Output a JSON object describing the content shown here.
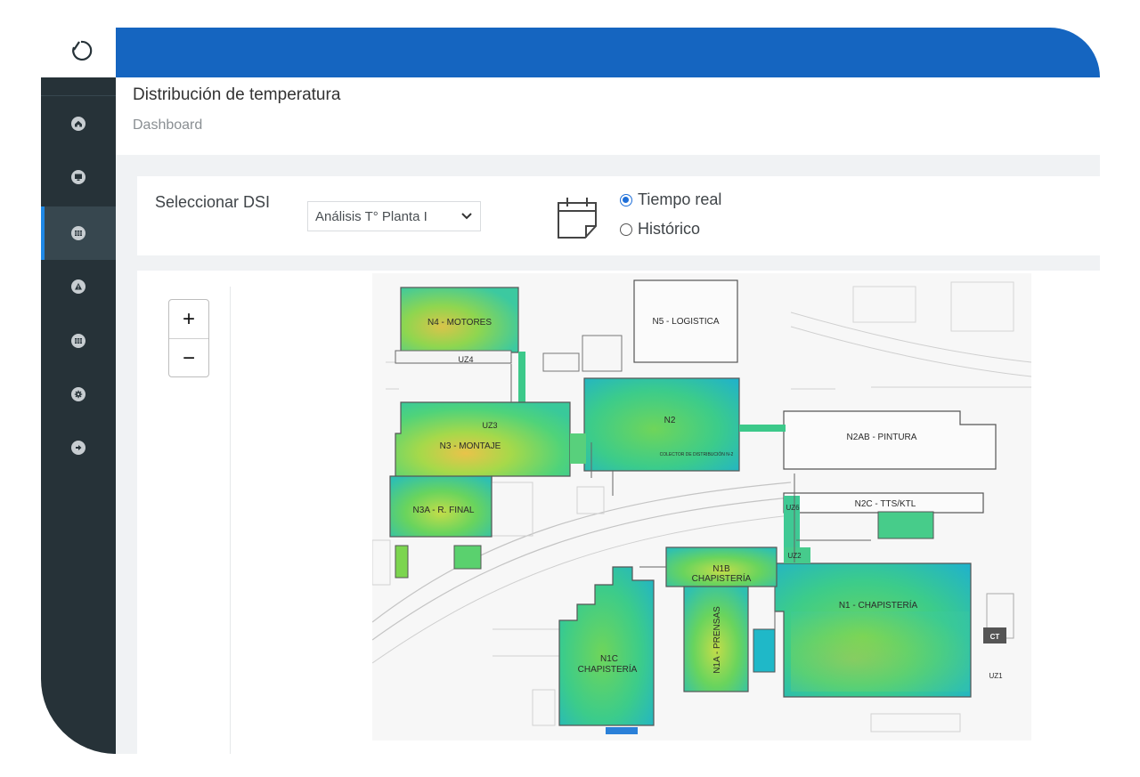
{
  "header": {
    "page_title": "Distribución de temperatura",
    "breadcrumb": "Dashboard"
  },
  "sidebar": {
    "items": [
      {
        "icon": "home-icon",
        "active": false
      },
      {
        "icon": "monitor-icon",
        "active": false
      },
      {
        "icon": "table-icon",
        "active": true
      },
      {
        "icon": "warning-icon",
        "active": false
      },
      {
        "icon": "grid-icon",
        "active": false
      },
      {
        "icon": "gear-icon",
        "active": false
      },
      {
        "icon": "logout-icon",
        "active": false
      }
    ]
  },
  "filters": {
    "select_label": "Seleccionar DSI",
    "dsi_value": "Análisis T° Planta I",
    "mode_options": [
      "Tiempo real",
      "Histórico"
    ],
    "mode_selected": "Tiempo real"
  },
  "map": {
    "zoom_in": "+",
    "zoom_out": "−",
    "buildings": {
      "n4": "N4 - MOTORES",
      "n5": "N5 - LOGISTICA",
      "uz4": "UZ4",
      "uz3": "UZ3",
      "n3": "N3 - MONTAJE",
      "n2": "N2",
      "collector": "COLECTOR DE DISTRIBUCIÓN N-2",
      "n2ab": "N2AB - PINTURA",
      "n3a": "N3A - R. FINAL",
      "n2c": "N2C - TTS/KTL",
      "uz6": "UZ6",
      "uz2": "UZ2",
      "n1b_1": "N1B",
      "n1b_2": "CHAPISTERÍA",
      "n1": "N1 - CHAPISTERÍA",
      "n1c_1": "N1C",
      "n1c_2": "CHAPISTERÍA",
      "n1a": "N1A - PRENSAS",
      "ct": "CT",
      "uz1": "UZ1"
    }
  },
  "colors": {
    "topbar": "#1565c0",
    "sidebar": "#263238",
    "accent": "#1e88e5"
  }
}
